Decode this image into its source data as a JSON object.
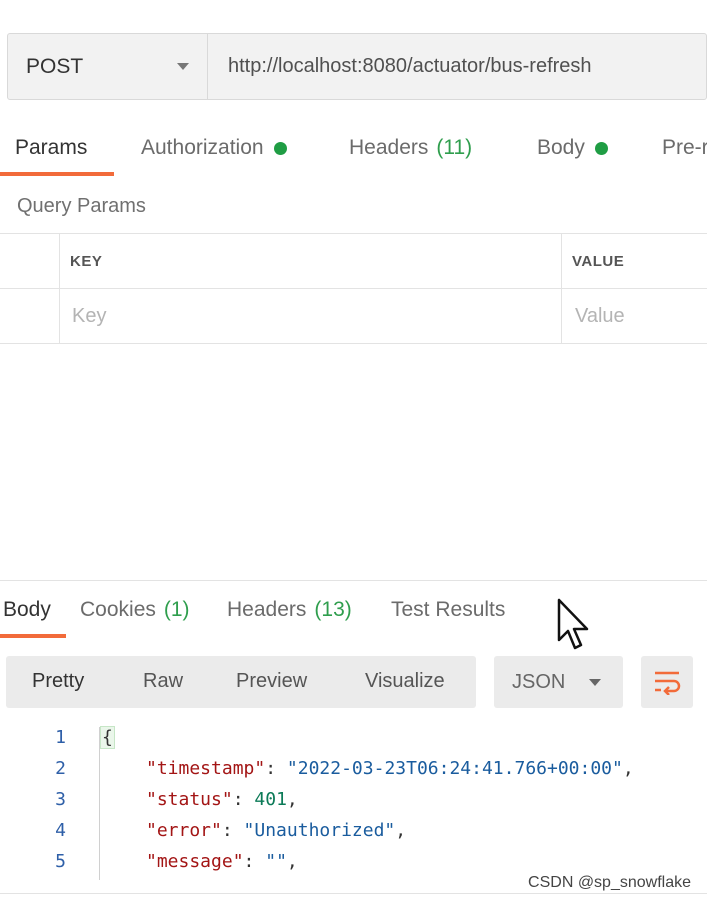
{
  "request": {
    "method": "POST",
    "url": "http://localhost:8080/actuator/bus-refresh"
  },
  "request_tabs": [
    {
      "label": "Params",
      "active": true
    },
    {
      "label": "Authorization",
      "dot": true
    },
    {
      "label": "Headers",
      "count": "(11)"
    },
    {
      "label": "Body",
      "dot": true
    },
    {
      "label": "Pre-r"
    }
  ],
  "query_params": {
    "label": "Query Params",
    "columns": [
      "KEY",
      "VALUE"
    ],
    "key_placeholder": "Key",
    "value_placeholder": "Value"
  },
  "response_tabs": [
    {
      "label": "Body",
      "active": true
    },
    {
      "label": "Cookies",
      "count": "(1)"
    },
    {
      "label": "Headers",
      "count": "(13)"
    },
    {
      "label": "Test Results"
    }
  ],
  "view_modes": [
    "Pretty",
    "Raw",
    "Preview",
    "Visualize"
  ],
  "format": "JSON",
  "code_lines": [
    {
      "n": "1"
    },
    {
      "n": "2",
      "key": "\"timestamp\"",
      "value": "\"2022-03-23T06:24:41.766+00:00\""
    },
    {
      "n": "3",
      "key": "\"status\"",
      "value": "401"
    },
    {
      "n": "4",
      "key": "\"error\"",
      "value": "\"Unauthorized\""
    },
    {
      "n": "5",
      "key": "\"message\"",
      "value": "\"\""
    }
  ],
  "watermark": "CSDN @sp_snowflake",
  "colors": {
    "accent": "#f26b3a",
    "green": "#1f9d44"
  }
}
